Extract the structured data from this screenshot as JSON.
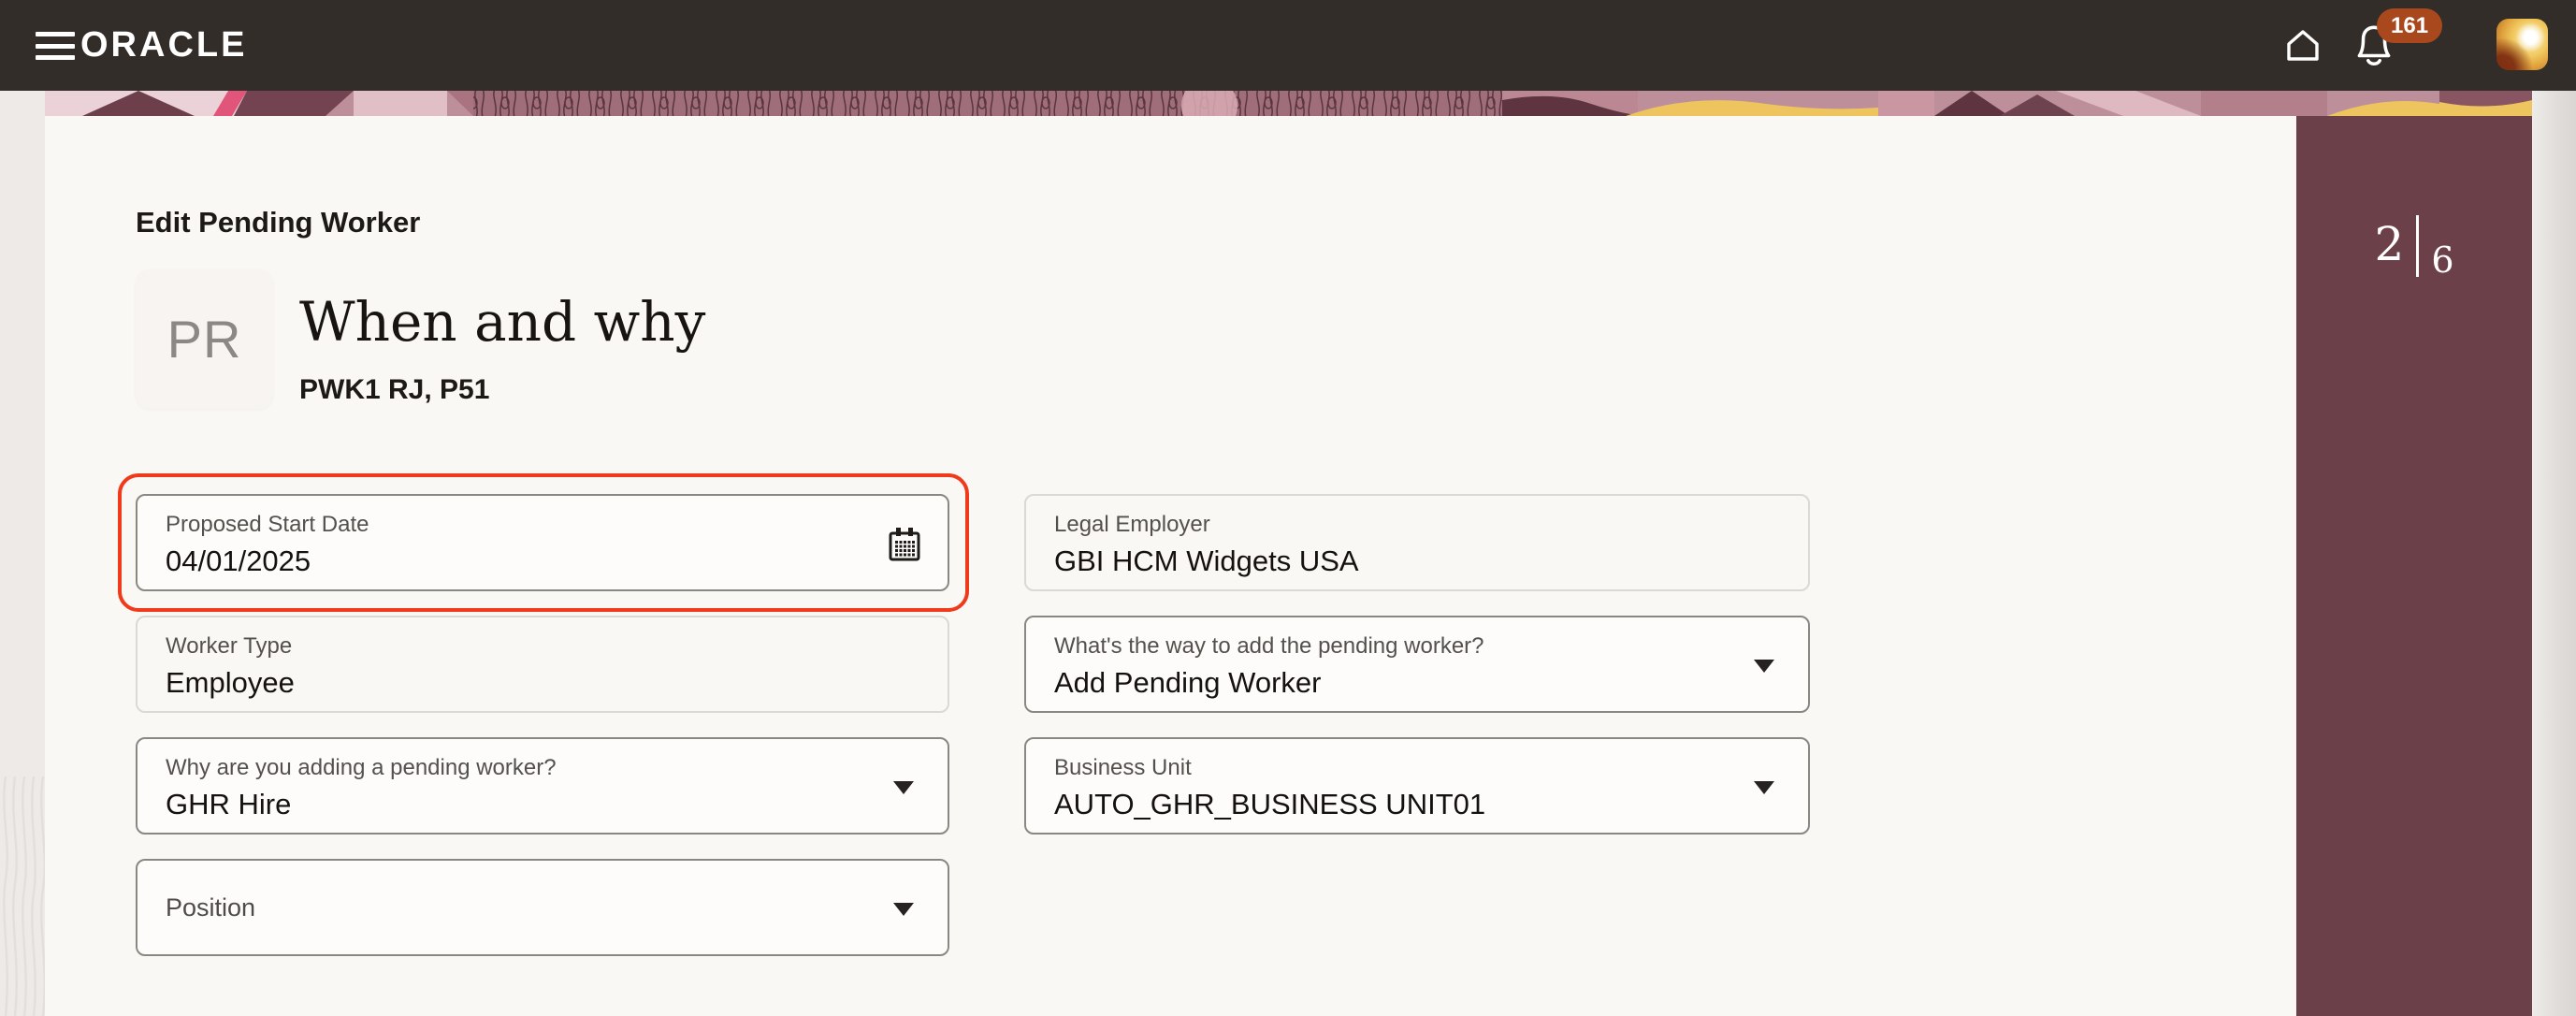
{
  "topbar": {
    "brand": "ORACLE",
    "notifications": {
      "count": "161"
    },
    "icons": {
      "menu": "hamburger-icon",
      "home": "home-icon",
      "bell": "bell-icon",
      "avatar": "user-avatar"
    }
  },
  "page": {
    "title": "Edit Pending Worker",
    "worker": {
      "initials": "PR",
      "section_heading": "When and why",
      "name": "PWK1 RJ, P51"
    },
    "step_indicator": {
      "current": "2",
      "total": "6"
    }
  },
  "form": {
    "fields": [
      {
        "id": "proposed-start-date",
        "label": "Proposed Start Date",
        "value": "04/01/2025",
        "type": "date",
        "highlighted": true,
        "icon": "calendar-icon"
      },
      {
        "id": "legal-employer",
        "label": "Legal Employer",
        "value": "GBI HCM Widgets USA",
        "type": "readonly"
      },
      {
        "id": "worker-type",
        "label": "Worker Type",
        "value": "Employee",
        "type": "readonly"
      },
      {
        "id": "way-to-add",
        "label": "What's the way to add the pending worker?",
        "value": "Add Pending Worker",
        "type": "dropdown",
        "icon": "chevron-down-icon"
      },
      {
        "id": "why-adding",
        "label": "Why are you adding a pending worker?",
        "value": "GHR Hire",
        "type": "dropdown",
        "icon": "chevron-down-icon"
      },
      {
        "id": "business-unit",
        "label": "Business Unit",
        "value": "AUTO_GHR_BUSINESS UNIT01",
        "type": "dropdown",
        "icon": "chevron-down-icon"
      },
      {
        "id": "position",
        "label": "Position",
        "value": "",
        "type": "dropdown",
        "icon": "chevron-down-icon"
      }
    ]
  },
  "colors": {
    "topbar_bg": "#332d29",
    "card_bg": "#faf8f5",
    "page_bg": "#edeae7",
    "sidebar_bg": "#6c4049",
    "badge_bg": "#a9481d",
    "highlight_red": "#ef3a1c",
    "banner_pink_stripe": "#e2557a",
    "banner_yellow": "#eec45f"
  }
}
